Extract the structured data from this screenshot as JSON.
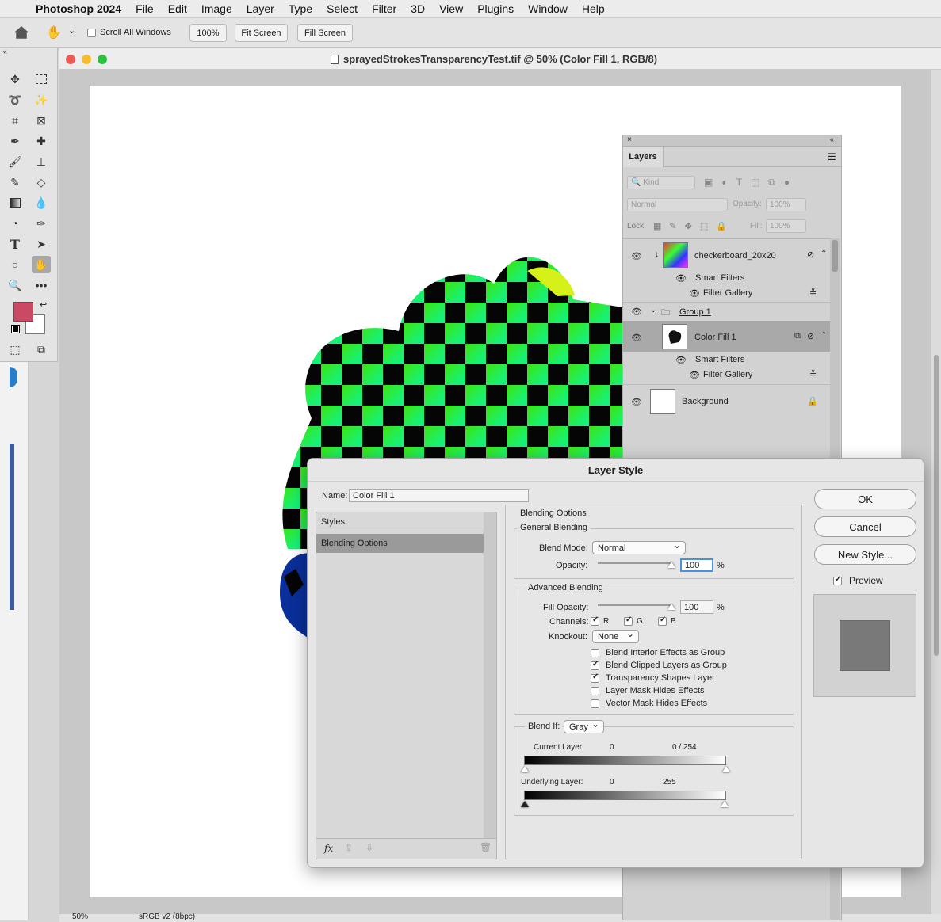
{
  "menubar": {
    "app_name": "Photoshop 2024",
    "items": [
      "File",
      "Edit",
      "Image",
      "Layer",
      "Type",
      "Select",
      "Filter",
      "3D",
      "View",
      "Plugins",
      "Window",
      "Help"
    ]
  },
  "options_bar": {
    "scroll_all_windows": "Scroll All Windows",
    "zoom_100": "100%",
    "fit_screen": "Fit Screen",
    "fill_screen": "Fill Screen"
  },
  "document": {
    "title": "sprayedStrokesTransparencyTest.tif @ 50% (Color Fill 1, RGB/8)"
  },
  "tools": {
    "foreground_color": "#c94a62",
    "background_color": "#ffffff"
  },
  "layers_panel": {
    "tab": "Layers",
    "filter_kind": "Kind",
    "blend_mode": "Normal",
    "opacity_label": "Opacity:",
    "opacity_value": "100%",
    "lock_label": "Lock:",
    "fill_label": "Fill:",
    "fill_value": "100%",
    "layers": [
      {
        "name": "checkerboard_20x20"
      },
      {
        "name": "Smart Filters"
      },
      {
        "name": "Filter Gallery"
      },
      {
        "name": "Group 1"
      },
      {
        "name": "Color Fill 1"
      },
      {
        "name": "Smart Filters"
      },
      {
        "name": "Filter Gallery"
      },
      {
        "name": "Background"
      }
    ]
  },
  "dialog": {
    "title": "Layer Style",
    "name_label": "Name:",
    "name_value": "Color Fill 1",
    "styles_header": "Styles",
    "styles_selected": "Blending Options",
    "blending_options": "Blending Options",
    "general_blending": "General Blending",
    "blend_mode_label": "Blend Mode:",
    "blend_mode_value": "Normal",
    "opacity_label": "Opacity:",
    "opacity_value": "100",
    "percent": "%",
    "advanced_blending": "Advanced Blending",
    "fill_opacity_label": "Fill Opacity:",
    "fill_opacity_value": "100",
    "channels_label": "Channels:",
    "channels": [
      "R",
      "G",
      "B"
    ],
    "knockout_label": "Knockout:",
    "knockout_value": "None",
    "options": [
      {
        "label": "Blend Interior Effects as Group",
        "checked": false
      },
      {
        "label": "Blend Clipped Layers as Group",
        "checked": true
      },
      {
        "label": "Transparency Shapes Layer",
        "checked": true
      },
      {
        "label": "Layer Mask Hides Effects",
        "checked": false
      },
      {
        "label": "Vector Mask Hides Effects",
        "checked": false
      }
    ],
    "blend_if_label": "Blend If:",
    "blend_if_value": "Gray",
    "current_layer_label": "Current Layer:",
    "current_low": "0",
    "current_high": "0  /  254",
    "underlying_layer_label": "Underlying Layer:",
    "underlying_low": "0",
    "underlying_high": "255",
    "ok": "OK",
    "cancel": "Cancel",
    "new_style": "New Style...",
    "preview": "Preview",
    "fx": "fx"
  },
  "status": {
    "zoom": "50%",
    "profile": "sRGB v2 (8bpc)"
  }
}
